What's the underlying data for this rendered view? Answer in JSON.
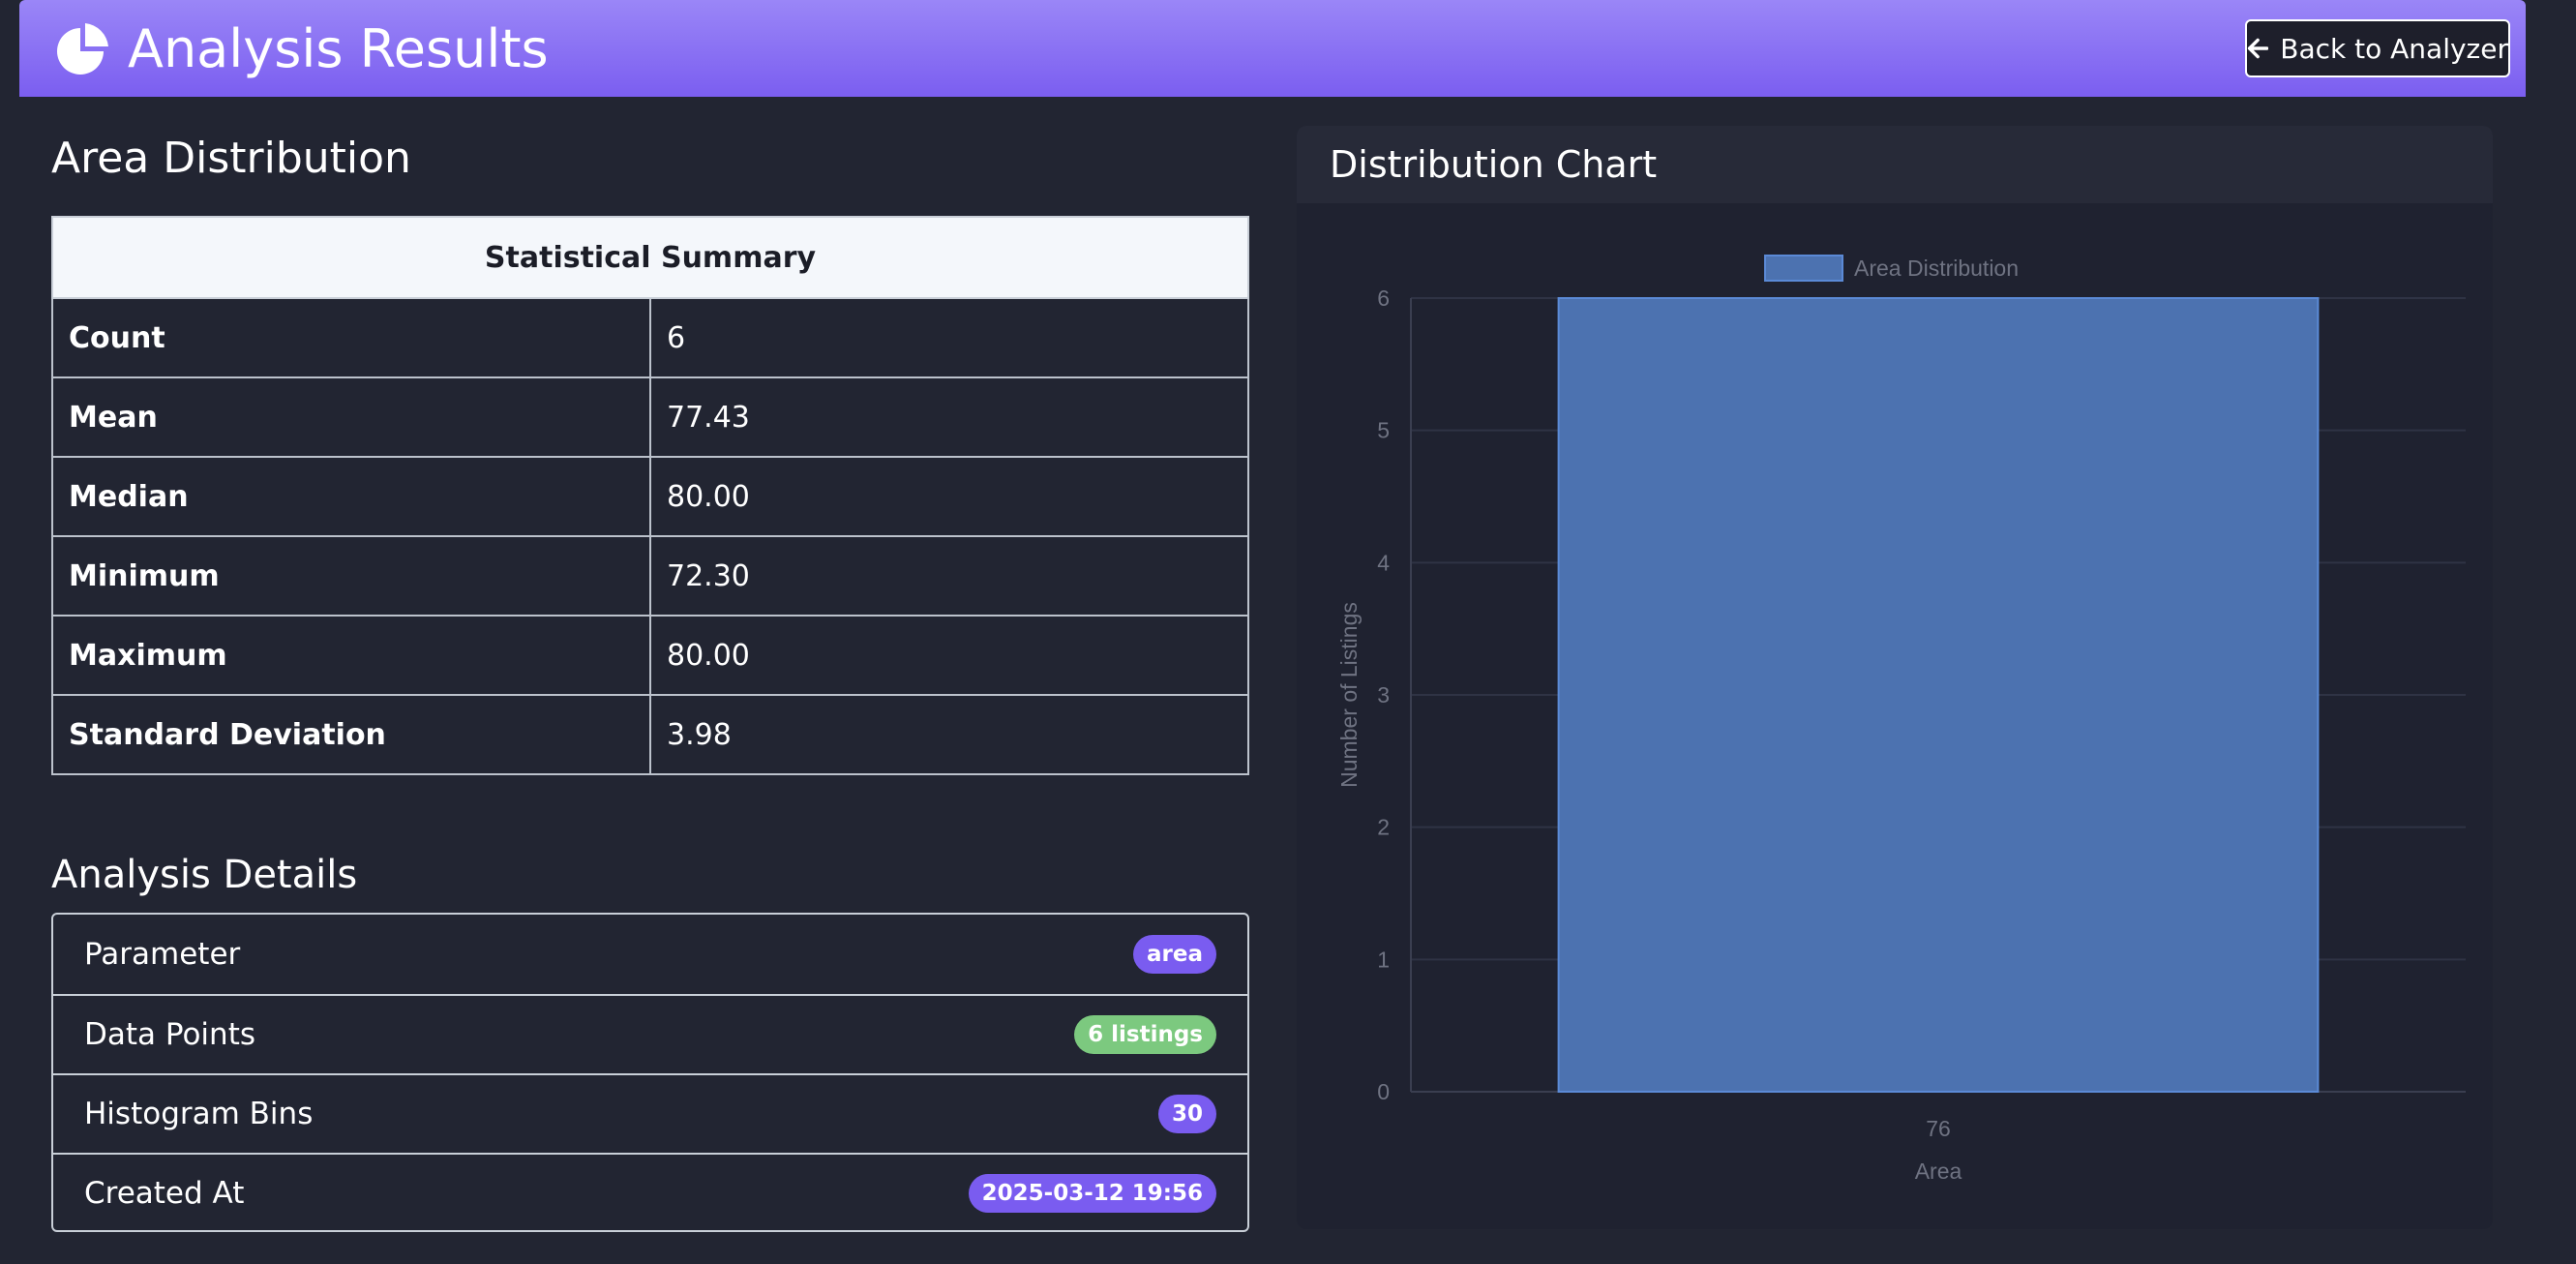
{
  "header": {
    "title": "Analysis Results",
    "back_label": "Back to Analyzer"
  },
  "summary": {
    "heading": "Area Distribution",
    "table_header": "Statistical Summary",
    "rows": [
      {
        "label": "Count",
        "value": "6"
      },
      {
        "label": "Mean",
        "value": "77.43"
      },
      {
        "label": "Median",
        "value": "80.00"
      },
      {
        "label": "Minimum",
        "value": "72.30"
      },
      {
        "label": "Maximum",
        "value": "80.00"
      },
      {
        "label": "Standard Deviation",
        "value": "3.98"
      }
    ]
  },
  "details": {
    "heading": "Analysis Details",
    "items": [
      {
        "label": "Parameter",
        "value": "area",
        "badge": "purple"
      },
      {
        "label": "Data Points",
        "value": "6 listings",
        "badge": "green"
      },
      {
        "label": "Histogram Bins",
        "value": "30",
        "badge": "purple"
      },
      {
        "label": "Created At",
        "value": "2025-03-12 19:56",
        "badge": "purple"
      }
    ]
  },
  "chart_card": {
    "title": "Distribution Chart"
  },
  "chart_data": {
    "type": "bar",
    "categories": [
      "76"
    ],
    "series": [
      {
        "name": "Area Distribution",
        "values": [
          6
        ]
      }
    ],
    "xlabel": "Area",
    "ylabel": "Number of Listings",
    "ylim": [
      0,
      6
    ],
    "yticks": [
      0,
      1,
      2,
      3,
      4,
      5,
      6
    ],
    "grid": true,
    "legend": "top",
    "bar_color": "#4c72b0",
    "bar_border": "#5b8ad6"
  },
  "colors": {
    "accent": "#7b5ef0",
    "badge_purple": "#7a5cf0",
    "badge_green": "#7cc97f",
    "background": "#222532"
  },
  "icons": {
    "logo": "pie-chart-icon",
    "back": "arrow-left-icon"
  }
}
